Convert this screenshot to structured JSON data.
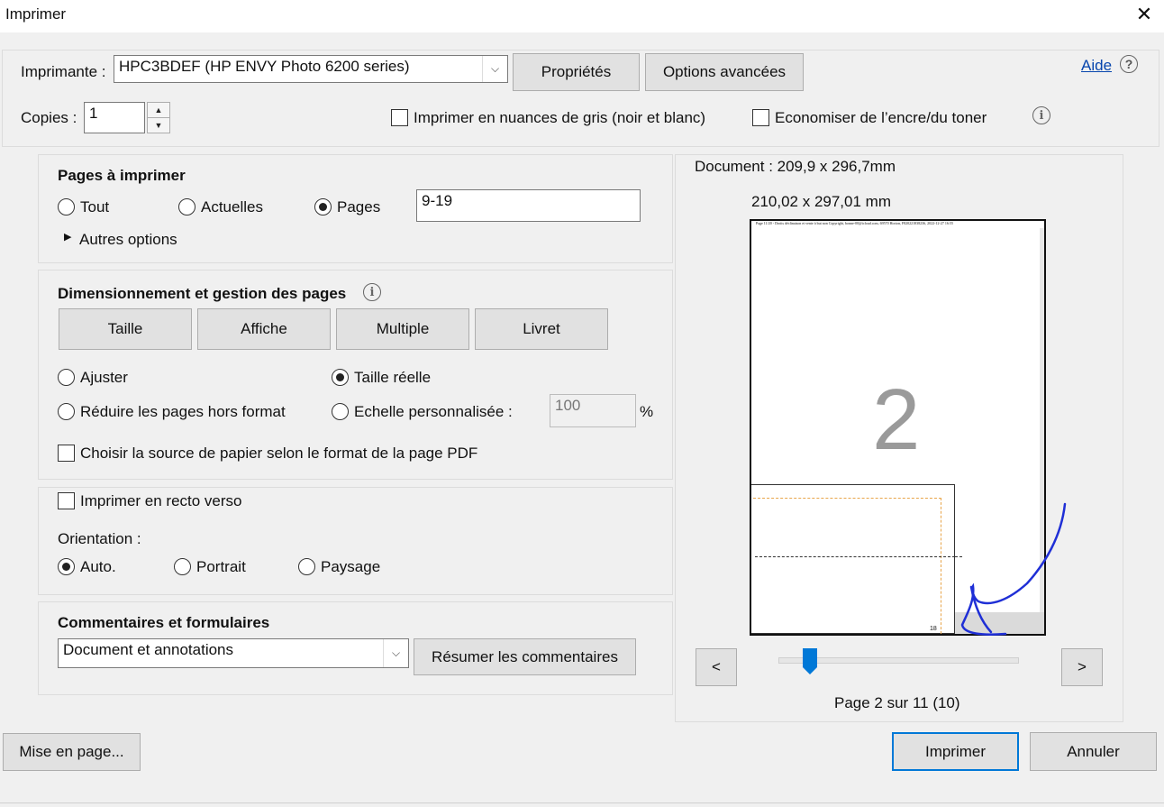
{
  "window": {
    "title": "Imprimer",
    "close_glyph": "✕"
  },
  "printer": {
    "label": "Imprimante :",
    "value": "HPC3BDEF (HP ENVY Photo 6200 series)",
    "properties_button": "Propriétés",
    "advanced_button": "Options avancées",
    "help_link": "Aide"
  },
  "copies": {
    "label": "Copies :",
    "value": "1"
  },
  "options": {
    "grayscale": "Imprimer en nuances de gris (noir et blanc)",
    "save_ink": "Economiser de l’encre/du toner"
  },
  "pages_section": {
    "title": "Pages à imprimer",
    "all": "Tout",
    "current": "Actuelles",
    "pages": "Pages",
    "range_value": "9-19",
    "more_options": "Autres options"
  },
  "sizing_section": {
    "title": "Dimensionnement et gestion des pages",
    "tabs": [
      "Taille",
      "Affiche",
      "Multiple",
      "Livret"
    ],
    "fit": "Ajuster",
    "actual_size": "Taille réelle",
    "shrink": "Réduire les pages hors format",
    "custom_scale": "Echelle personnalisée :",
    "scale_value": "100",
    "percent": "%",
    "paper_source": "Choisir la source de papier selon le format de la page PDF"
  },
  "duplex_section": {
    "duplex": "Imprimer en recto verso",
    "orientation_label": "Orientation :",
    "auto": "Auto.",
    "portrait": "Portrait",
    "landscape": "Paysage"
  },
  "comments_section": {
    "title": "Commentaires et formulaires",
    "value": "Document et annotations",
    "summarize_button": "Résumer les commentaires"
  },
  "preview": {
    "document_size": "Document : 209,9 x 296,7mm",
    "paper_size": "210,02 x 297,01 mm",
    "page_number_big": "2",
    "header_text": "Page 11/20 - Droits déclinaison et vente à but non Copyright, bonne-00@icloud.com, 69570 Horion, F820221838236, 2022-12-27 16:55",
    "footer_num": "18",
    "prev_button": "<",
    "next_button": ">",
    "page_status": "Page 2 sur 11 (10)",
    "slider_fraction": 0.13
  },
  "footer": {
    "page_setup_button": "Mise en page...",
    "print_button": "Imprimer",
    "cancel_button": "Annuler"
  },
  "colors": {
    "accent": "#0078d7",
    "handwriting": "#1f2fd6",
    "dashed_orange": "#e8a54a"
  }
}
